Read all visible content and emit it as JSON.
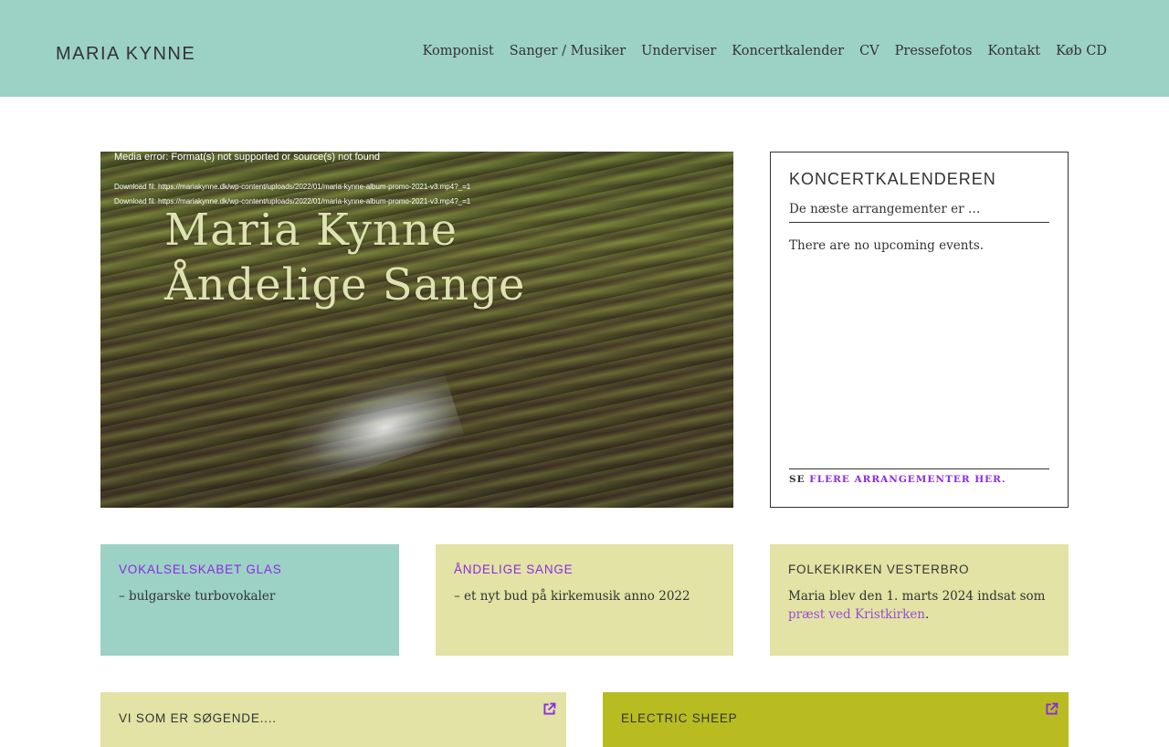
{
  "header": {
    "logo": "MARIA KYNNE",
    "nav": [
      "Komponist",
      "Sanger / Musiker",
      "Underviser",
      "Koncertkalender",
      "CV",
      "Pressefotos",
      "Kontakt",
      "Køb CD"
    ]
  },
  "video": {
    "error": "Media error: Format(s) not supported or source(s) not found",
    "download_1": "Download fil: https://mariakynne.dk/wp-content/uploads/2022/01/maria-kynne-album-promo-2021-v3.mp4?_=1",
    "download_2": "Download fil: https://mariakynne.dk/wp-content/uploads/2022/01/maria-kynne-album-promo-2021-v3.mp4?_=1",
    "title_line1": "Maria Kynne",
    "title_line2": "Åndelige Sange"
  },
  "concerts": {
    "heading": "KONCERTKALENDEREN",
    "subtitle": "De næste arrangementer er …",
    "empty": "There are no upcoming events.",
    "more_prefix": "SE ",
    "more_link": "FLERE ARRANGEMENTER HER."
  },
  "cards": [
    {
      "title": "VOKALSELSKABET GLAS",
      "text": "– bulgarske turbovokaler",
      "bg": "#9cd1c5",
      "title_color": "#8a2be2"
    },
    {
      "title": "ÅNDELIGE SANGE",
      "text": "– et nyt bud på kirkemusik anno 2022",
      "bg": "#e2e3a4",
      "title_color": "#8a2be2"
    },
    {
      "title": "FOLKEKIRKEN VESTERBRO",
      "text_before": "Maria blev den 1. marts 2024 indsat som ",
      "link": "præst ved Kristkirken",
      "text_after": ".",
      "bg": "#e2e3a4",
      "title_color": "#333333"
    }
  ],
  "bottom": [
    {
      "title": "VI SOM ER SØGENDE....",
      "bg": "#e2e3a4",
      "icon": "external-link-icon"
    },
    {
      "title": "ELECTRIC SHEEP",
      "bg": "#b8bc20",
      "icon": "external-link-icon"
    }
  ],
  "colors": {
    "header_bg": "#9cd1c5",
    "accent": "#8a2be2",
    "text": "#333333"
  }
}
